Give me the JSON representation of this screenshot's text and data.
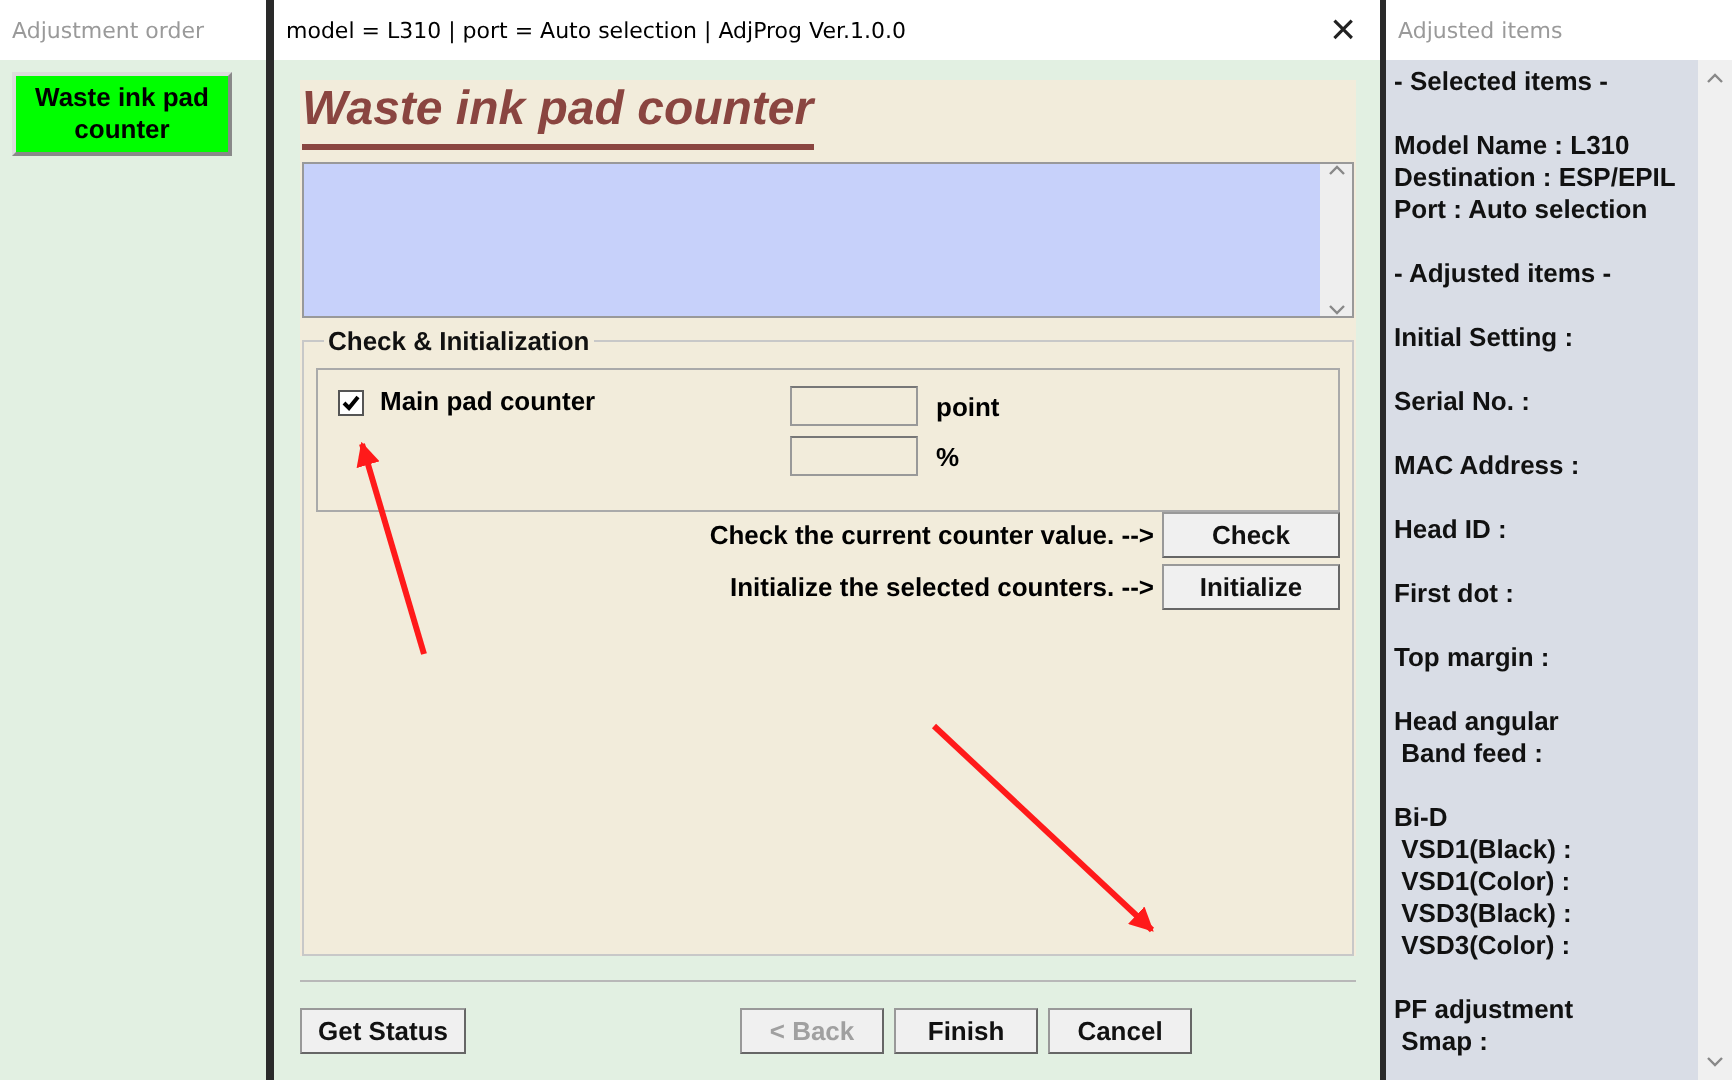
{
  "left_window": {
    "title": "Adjustment order",
    "items": [
      {
        "label": "Waste ink pad\ncounter",
        "selected": true
      }
    ]
  },
  "main_window": {
    "title": "model = L310 | port = Auto selection | AdjProg Ver.1.0.0",
    "close": "×",
    "heading": "Waste ink pad counter",
    "group": {
      "title": "Check & Initialization",
      "counters": [
        {
          "label": "Main pad counter",
          "checked": true,
          "units": [
            "point",
            "%"
          ]
        }
      ],
      "actions": [
        {
          "text": "Check the current counter value. -->",
          "button": "Check"
        },
        {
          "text": "Initialize the selected counters. -->",
          "button": "Initialize"
        }
      ]
    },
    "status_button": "Get Status",
    "buttons": [
      {
        "label": "< Back",
        "disabled": true
      },
      {
        "label": "Finish",
        "disabled": false
      },
      {
        "label": "Cancel",
        "disabled": false
      }
    ]
  },
  "right_window": {
    "title": "Adjusted items",
    "groups": [
      {
        "lines": [
          "- Selected items -"
        ]
      },
      {
        "lines": [
          "Model Name : L310",
          "Destination : ESP/EPIL",
          "Port : Auto selection"
        ]
      },
      {
        "lines": [
          "- Adjusted items -"
        ]
      },
      {
        "lines": [
          "Initial Setting :"
        ]
      },
      {
        "lines": [
          "Serial No. :"
        ]
      },
      {
        "lines": [
          "MAC Address :"
        ]
      },
      {
        "lines": [
          "Head ID :"
        ]
      },
      {
        "lines": [
          "First dot :"
        ]
      },
      {
        "lines": [
          "Top margin :"
        ]
      },
      {
        "lines": [
          "Head angular",
          " Band feed :"
        ]
      },
      {
        "lines": [
          "Bi-D",
          " VSD1(Black) :",
          " VSD1(Color) :",
          " VSD3(Black) :",
          " VSD3(Color) :"
        ]
      },
      {
        "lines": [
          "PF adjustment",
          " Smap :"
        ]
      }
    ]
  }
}
